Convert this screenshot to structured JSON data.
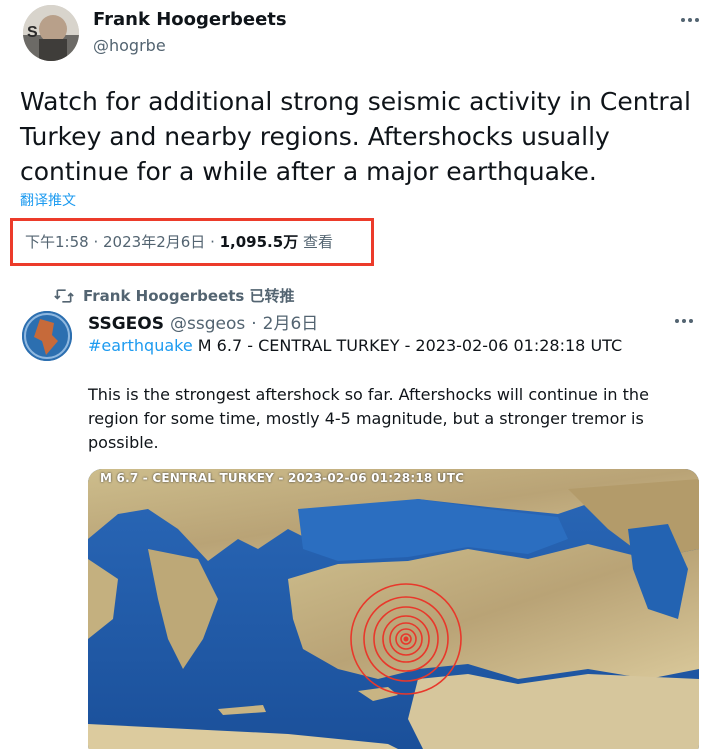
{
  "author": {
    "name": "Frank Hoogerbeets",
    "handle": "@hogrbe"
  },
  "tweet": {
    "text": "Watch for additional strong seismic activity in Central Turkey and nearby regions. Aftershocks usually continue for a while after a major earthquake.",
    "translate_label": "翻译推文",
    "time": "下午1:58",
    "date": "2023年2月6日",
    "views_count": "1,095.5万",
    "views_label": "查看"
  },
  "retweet": {
    "label": "Frank Hoogerbeets 已转推"
  },
  "quoted": {
    "name": "SSGEOS",
    "handle": "@ssgeos",
    "date": "2月6日",
    "hashtag": "#earthquake",
    "headline": "M 6.7 - CENTRAL TURKEY - 2023-02-06 01:28:18 UTC",
    "body": "This is the strongest aftershock so far. Aftershocks will continue in the region for some time, mostly 4-5 magnitude, but a stronger tremor is possible.",
    "map_caption": "M 6.7 - CENTRAL TURKEY - 2023-02-06 01:28:18 UTC"
  },
  "icons": {
    "more": "more-icon",
    "retweet": "retweet-icon"
  },
  "colors": {
    "link": "#1d9bf0",
    "highlight_box": "#ec3b2a",
    "sea": "#1f5aa8",
    "land": "#c8b88a",
    "epicenter": "#e8382b"
  }
}
